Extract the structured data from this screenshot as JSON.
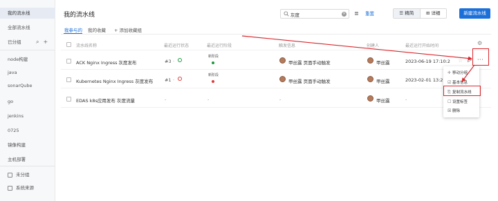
{
  "sidebar": {
    "items": [
      {
        "label": "我的流水线",
        "active": true
      },
      {
        "label": "全部流水线"
      },
      {
        "label": "已分组"
      },
      {
        "label": "node构建"
      },
      {
        "label": "java"
      },
      {
        "label": "sonarQube"
      },
      {
        "label": "go"
      },
      {
        "label": "jenkins"
      },
      {
        "label": "0725"
      },
      {
        "label": "镜像构建"
      },
      {
        "label": "主机部署"
      }
    ],
    "footer": [
      {
        "label": "未分组"
      },
      {
        "label": "系统来源"
      }
    ]
  },
  "header": {
    "title": "我的流水线",
    "search_value": "灰度",
    "reset_label": "重置",
    "view_compact": "精简",
    "view_detail": "详细",
    "new_button": "新建流水线"
  },
  "tabs": [
    {
      "label": "我参与的",
      "active": true
    },
    {
      "label": "我的收藏"
    },
    {
      "label": "添加收藏组"
    }
  ],
  "table": {
    "columns": [
      "流水线名称",
      "最近运行状态",
      "最近运行阶段",
      "触发信息",
      "创建人",
      "最近运行开始时间"
    ],
    "rows": [
      {
        "name": "ACK Nginx Ingress 灰度发布",
        "run_no": "#3",
        "stage": "新阶段",
        "trigger": "甲丝露 页面手动触发",
        "creator": "甲丝露",
        "start_time": "2023-06-19 17:10:2"
      },
      {
        "name": "Kubernetes Nginx Ingress 灰度发布",
        "run_no": "#1",
        "stage": "新阶段",
        "trigger": "甲丝露 页面手动触发",
        "creator": "甲丝露",
        "start_time": "2023-02-01 13:27:2"
      },
      {
        "name": "EDAS k8s应用发布 灰度流量",
        "run_no": "-",
        "stage": "-",
        "trigger": "-",
        "creator": "甲丝露",
        "start_time": "-"
      }
    ]
  },
  "dropdown": {
    "items": [
      {
        "label": "移动分组",
        "icon": "move-icon"
      },
      {
        "label": "基本信息",
        "icon": "info-icon"
      },
      {
        "label": "复制流水线",
        "icon": "copy-icon",
        "highlighted": true
      },
      {
        "label": "设置标签",
        "icon": "tag-icon"
      },
      {
        "label": "删除",
        "icon": "delete-icon"
      }
    ]
  },
  "colors": {
    "accent": "#1b6fd9",
    "success": "#1e9a3f",
    "failure": "#e23a3a",
    "annotation": "#d9262b"
  }
}
